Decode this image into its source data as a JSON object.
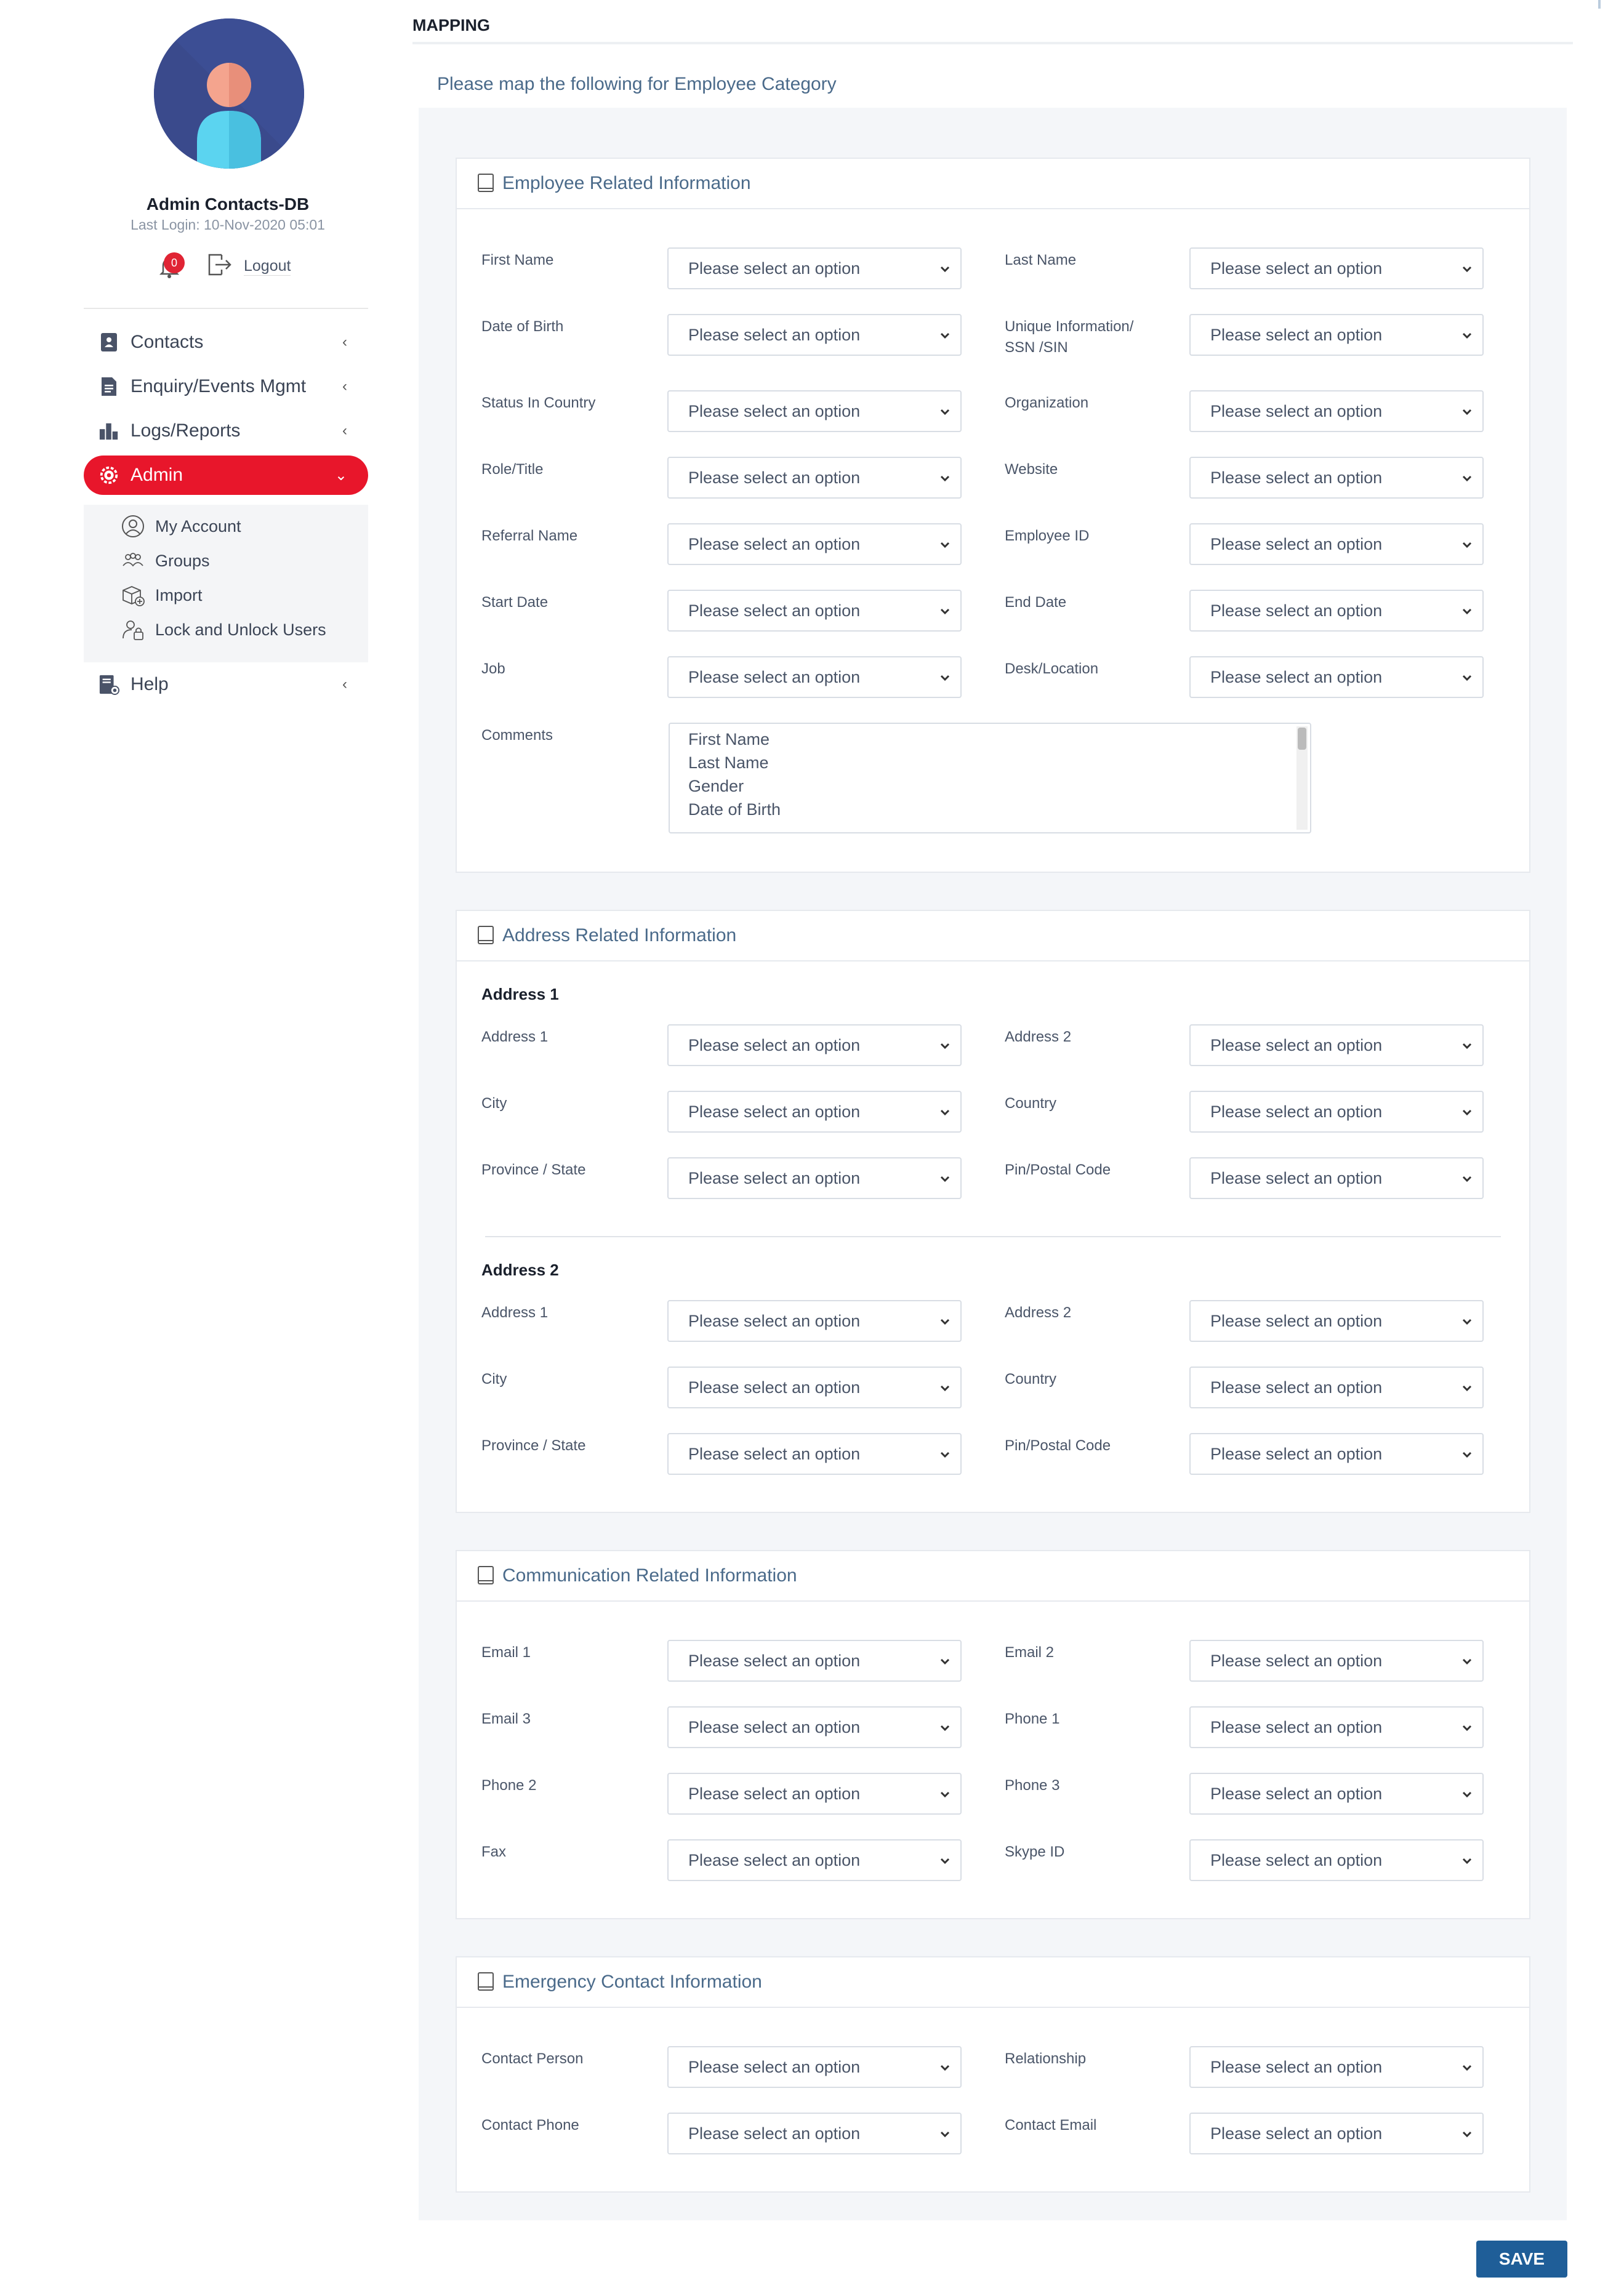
{
  "sidebar": {
    "user_name": "Admin Contacts-DB",
    "last_login": "Last Login: 10-Nov-2020 05:01",
    "notification_count": "0",
    "logout_label": "Logout",
    "nav": {
      "contacts": "Contacts",
      "enquiry": "Enquiry/Events Mgmt",
      "logs": "Logs/Reports",
      "admin": "Admin",
      "help": "Help"
    },
    "admin_sub": {
      "my_account": "My Account",
      "groups": "Groups",
      "import": "Import",
      "lock": "Lock and Unlock Users"
    }
  },
  "main": {
    "title": "MAPPING",
    "subtitle": "Please map the following for Employee Category",
    "placeholder": "Please select an option",
    "save_label": "SAVE",
    "employee": {
      "title": "Employee Related Information",
      "first_name": "First Name",
      "last_name": "Last Name",
      "dob": "Date of Birth",
      "unique_1": "Unique Information/",
      "unique_2": "SSN /SIN",
      "status": "Status In Country",
      "organization": "Organization",
      "role": "Role/Title",
      "website": "Website",
      "referral": "Referral Name",
      "employee_id": "Employee ID",
      "start_date": "Start Date",
      "end_date": "End Date",
      "job": "Job",
      "desk": "Desk/Location",
      "comments": "Comments",
      "comments_options": [
        "First Name",
        "Last Name",
        "Gender",
        "Date of Birth"
      ]
    },
    "address": {
      "title": "Address Related Information",
      "group1": "Address 1",
      "group2": "Address 2",
      "addr1": "Address 1",
      "addr2": "Address 2",
      "city": "City",
      "country": "Country",
      "province": "Province / State",
      "pin": "Pin/Postal Code"
    },
    "communication": {
      "title": "Communication Related Information",
      "email1": "Email 1",
      "email2": "Email 2",
      "email3": "Email 3",
      "phone1": "Phone 1",
      "phone2": "Phone 2",
      "phone3": "Phone 3",
      "fax": "Fax",
      "skype": "Skype ID"
    },
    "emergency": {
      "title": "Emergency Contact Information",
      "person": "Contact Person",
      "relationship": "Relationship",
      "phone": "Contact Phone",
      "email": "Contact Email"
    }
  },
  "colors": {
    "admin_active": "#e8162b",
    "save_button": "#1f5e98",
    "section_title": "#4a6a8a"
  }
}
